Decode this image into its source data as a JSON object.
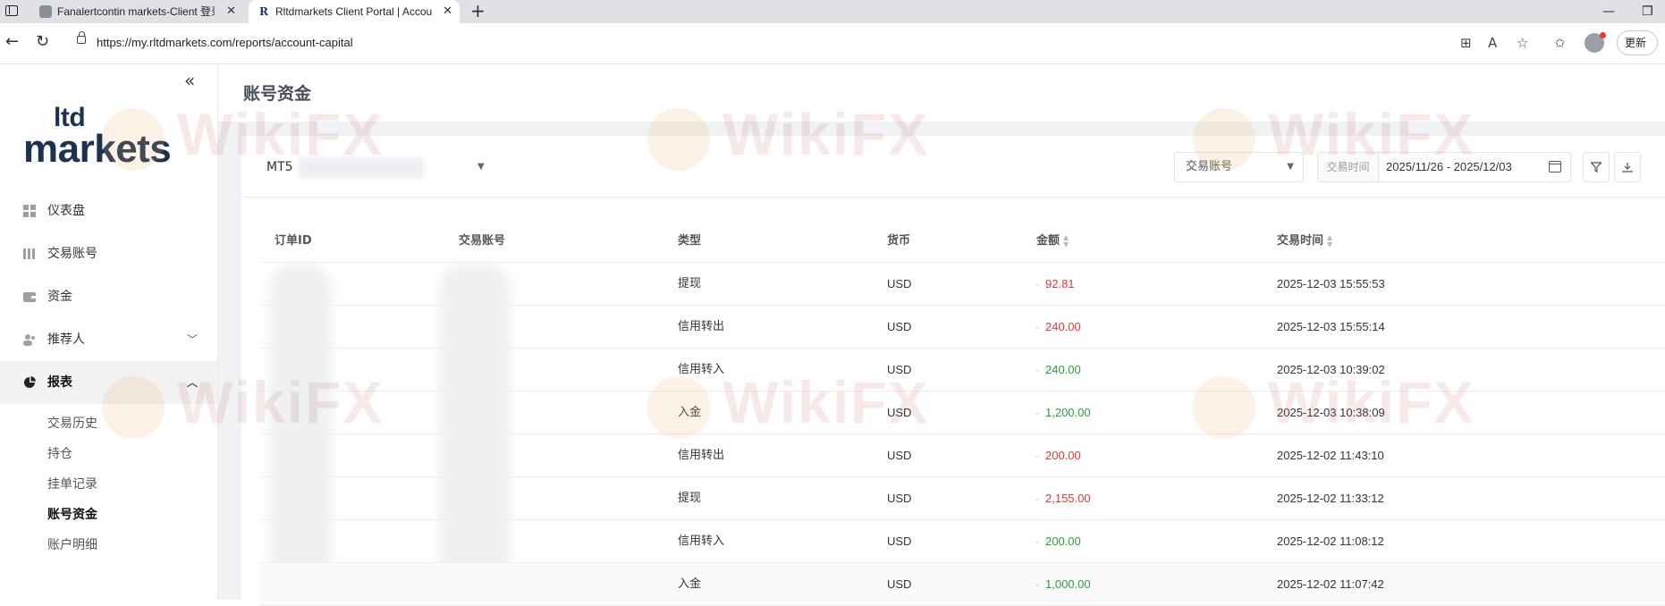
{
  "browser": {
    "tabs": [
      {
        "title": "Fanalertcontin markets-Client 登录"
      },
      {
        "title": "Rltdmarkets Client Portal | Account Capital"
      }
    ],
    "url": "https://my.rltdmarkets.com/reports/account-capital",
    "update_label": "更新"
  },
  "logo": {
    "line1": "ltd",
    "line2": "markets"
  },
  "sidebar": {
    "items": [
      {
        "label": "仪表盘",
        "icon": "dashboard-icon"
      },
      {
        "label": "交易账号",
        "icon": "accounts-icon"
      },
      {
        "label": "资金",
        "icon": "wallet-icon"
      },
      {
        "label": "推荐人",
        "icon": "referral-icon"
      },
      {
        "label": "报表",
        "icon": "pie-chart-icon"
      }
    ],
    "sub_items": [
      {
        "label": "交易历史"
      },
      {
        "label": "持仓"
      },
      {
        "label": "挂单记录"
      },
      {
        "label": "账号资金"
      },
      {
        "label": "账户明细"
      }
    ]
  },
  "page": {
    "title": "账号资金"
  },
  "filters": {
    "account_prefix": "MT5",
    "trade_account_placeholder": "交易账号",
    "date_label": "交易时间",
    "date_range": "2025/11/26 - 2025/12/03"
  },
  "table": {
    "headers": {
      "order_id": "订单ID",
      "account": "交易账号",
      "type": "类型",
      "currency": "货币",
      "amount": "金额",
      "time": "交易时间"
    },
    "rows": [
      {
        "type": "提现",
        "currency": "USD",
        "amount": "92.81",
        "sign": "neg",
        "time": "2025-12-03 15:55:53"
      },
      {
        "type": "信用转出",
        "currency": "USD",
        "amount": "240.00",
        "sign": "neg",
        "time": "2025-12-03 15:55:14"
      },
      {
        "type": "信用转入",
        "currency": "USD",
        "amount": "240.00",
        "sign": "pos",
        "time": "2025-12-03 10:39:02"
      },
      {
        "type": "入金",
        "currency": "USD",
        "amount": "1,200.00",
        "sign": "pos",
        "time": "2025-12-03 10:38:09"
      },
      {
        "type": "信用转出",
        "currency": "USD",
        "amount": "200.00",
        "sign": "neg",
        "time": "2025-12-02 11:43:10"
      },
      {
        "type": "提现",
        "currency": "USD",
        "amount": "2,155.00",
        "sign": "neg",
        "time": "2025-12-02 11:33:12"
      },
      {
        "type": "信用转入",
        "currency": "USD",
        "amount": "200.00",
        "sign": "pos",
        "time": "2025-12-02 11:08:12"
      },
      {
        "type": "入金",
        "currency": "USD",
        "amount": "1,000.00",
        "sign": "pos",
        "time": "2025-12-02 11:07:42"
      }
    ]
  },
  "watermark": "WikiFX",
  "colors": {
    "negative": "#e53935",
    "positive": "#2e9d3a",
    "brand": "#1c3350"
  }
}
